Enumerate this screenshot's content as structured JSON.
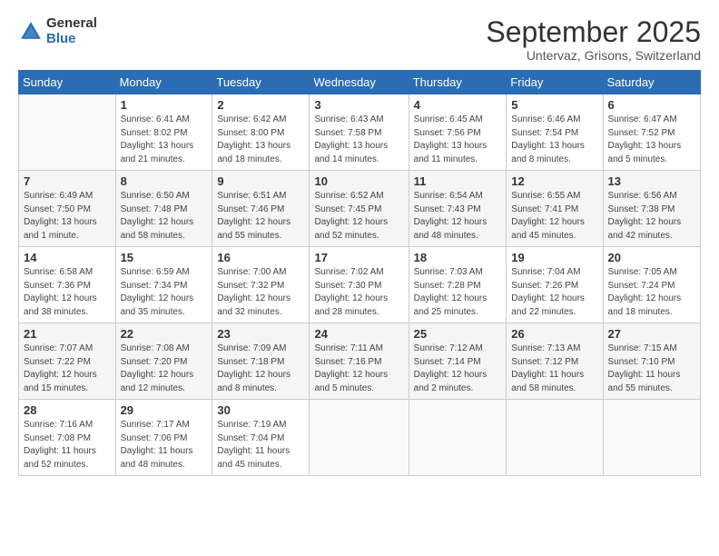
{
  "logo": {
    "general": "General",
    "blue": "Blue"
  },
  "title": "September 2025",
  "subtitle": "Untervaz, Grisons, Switzerland",
  "days_of_week": [
    "Sunday",
    "Monday",
    "Tuesday",
    "Wednesday",
    "Thursday",
    "Friday",
    "Saturday"
  ],
  "weeks": [
    [
      {
        "num": "",
        "info": ""
      },
      {
        "num": "1",
        "info": "Sunrise: 6:41 AM\nSunset: 8:02 PM\nDaylight: 13 hours\nand 21 minutes."
      },
      {
        "num": "2",
        "info": "Sunrise: 6:42 AM\nSunset: 8:00 PM\nDaylight: 13 hours\nand 18 minutes."
      },
      {
        "num": "3",
        "info": "Sunrise: 6:43 AM\nSunset: 7:58 PM\nDaylight: 13 hours\nand 14 minutes."
      },
      {
        "num": "4",
        "info": "Sunrise: 6:45 AM\nSunset: 7:56 PM\nDaylight: 13 hours\nand 11 minutes."
      },
      {
        "num": "5",
        "info": "Sunrise: 6:46 AM\nSunset: 7:54 PM\nDaylight: 13 hours\nand 8 minutes."
      },
      {
        "num": "6",
        "info": "Sunrise: 6:47 AM\nSunset: 7:52 PM\nDaylight: 13 hours\nand 5 minutes."
      }
    ],
    [
      {
        "num": "7",
        "info": "Sunrise: 6:49 AM\nSunset: 7:50 PM\nDaylight: 13 hours\nand 1 minute."
      },
      {
        "num": "8",
        "info": "Sunrise: 6:50 AM\nSunset: 7:48 PM\nDaylight: 12 hours\nand 58 minutes."
      },
      {
        "num": "9",
        "info": "Sunrise: 6:51 AM\nSunset: 7:46 PM\nDaylight: 12 hours\nand 55 minutes."
      },
      {
        "num": "10",
        "info": "Sunrise: 6:52 AM\nSunset: 7:45 PM\nDaylight: 12 hours\nand 52 minutes."
      },
      {
        "num": "11",
        "info": "Sunrise: 6:54 AM\nSunset: 7:43 PM\nDaylight: 12 hours\nand 48 minutes."
      },
      {
        "num": "12",
        "info": "Sunrise: 6:55 AM\nSunset: 7:41 PM\nDaylight: 12 hours\nand 45 minutes."
      },
      {
        "num": "13",
        "info": "Sunrise: 6:56 AM\nSunset: 7:38 PM\nDaylight: 12 hours\nand 42 minutes."
      }
    ],
    [
      {
        "num": "14",
        "info": "Sunrise: 6:58 AM\nSunset: 7:36 PM\nDaylight: 12 hours\nand 38 minutes."
      },
      {
        "num": "15",
        "info": "Sunrise: 6:59 AM\nSunset: 7:34 PM\nDaylight: 12 hours\nand 35 minutes."
      },
      {
        "num": "16",
        "info": "Sunrise: 7:00 AM\nSunset: 7:32 PM\nDaylight: 12 hours\nand 32 minutes."
      },
      {
        "num": "17",
        "info": "Sunrise: 7:02 AM\nSunset: 7:30 PM\nDaylight: 12 hours\nand 28 minutes."
      },
      {
        "num": "18",
        "info": "Sunrise: 7:03 AM\nSunset: 7:28 PM\nDaylight: 12 hours\nand 25 minutes."
      },
      {
        "num": "19",
        "info": "Sunrise: 7:04 AM\nSunset: 7:26 PM\nDaylight: 12 hours\nand 22 minutes."
      },
      {
        "num": "20",
        "info": "Sunrise: 7:05 AM\nSunset: 7:24 PM\nDaylight: 12 hours\nand 18 minutes."
      }
    ],
    [
      {
        "num": "21",
        "info": "Sunrise: 7:07 AM\nSunset: 7:22 PM\nDaylight: 12 hours\nand 15 minutes."
      },
      {
        "num": "22",
        "info": "Sunrise: 7:08 AM\nSunset: 7:20 PM\nDaylight: 12 hours\nand 12 minutes."
      },
      {
        "num": "23",
        "info": "Sunrise: 7:09 AM\nSunset: 7:18 PM\nDaylight: 12 hours\nand 8 minutes."
      },
      {
        "num": "24",
        "info": "Sunrise: 7:11 AM\nSunset: 7:16 PM\nDaylight: 12 hours\nand 5 minutes."
      },
      {
        "num": "25",
        "info": "Sunrise: 7:12 AM\nSunset: 7:14 PM\nDaylight: 12 hours\nand 2 minutes."
      },
      {
        "num": "26",
        "info": "Sunrise: 7:13 AM\nSunset: 7:12 PM\nDaylight: 11 hours\nand 58 minutes."
      },
      {
        "num": "27",
        "info": "Sunrise: 7:15 AM\nSunset: 7:10 PM\nDaylight: 11 hours\nand 55 minutes."
      }
    ],
    [
      {
        "num": "28",
        "info": "Sunrise: 7:16 AM\nSunset: 7:08 PM\nDaylight: 11 hours\nand 52 minutes."
      },
      {
        "num": "29",
        "info": "Sunrise: 7:17 AM\nSunset: 7:06 PM\nDaylight: 11 hours\nand 48 minutes."
      },
      {
        "num": "30",
        "info": "Sunrise: 7:19 AM\nSunset: 7:04 PM\nDaylight: 11 hours\nand 45 minutes."
      },
      {
        "num": "",
        "info": ""
      },
      {
        "num": "",
        "info": ""
      },
      {
        "num": "",
        "info": ""
      },
      {
        "num": "",
        "info": ""
      }
    ]
  ]
}
